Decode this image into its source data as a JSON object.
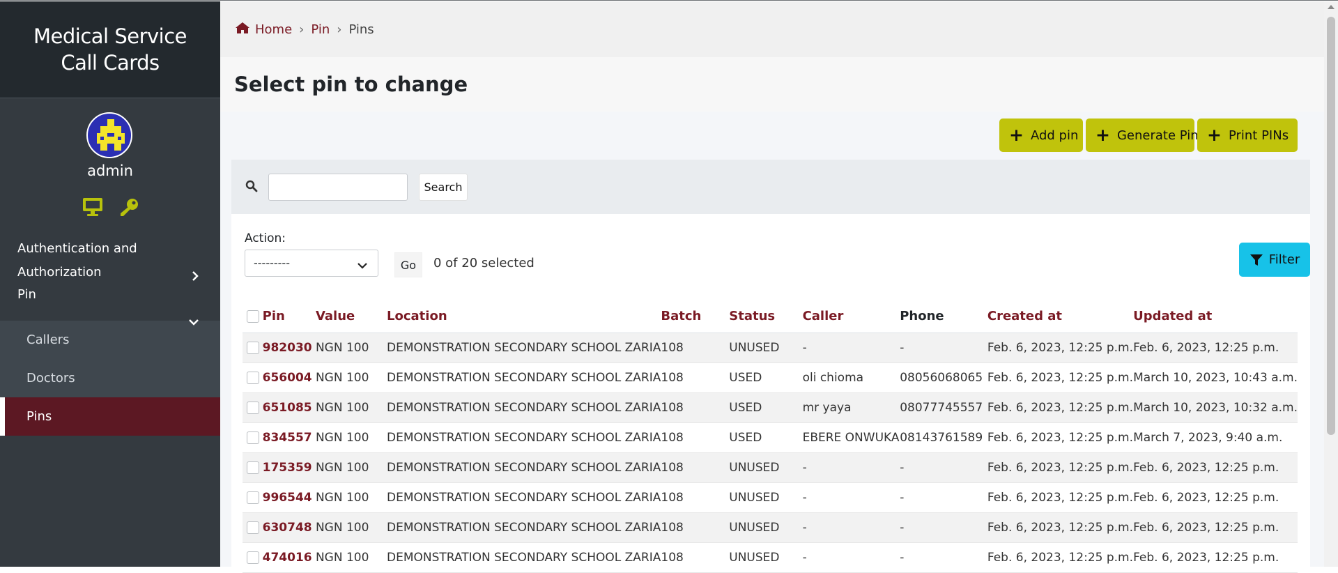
{
  "brand": {
    "title": "Medical Service Call Cards"
  },
  "user": {
    "name": "admin",
    "icons": [
      "monitor-icon",
      "key-icon"
    ]
  },
  "sidebar": {
    "items": [
      {
        "label": "Authentication and Authorization",
        "icon": "chevron-right-icon"
      },
      {
        "label": "Pin",
        "icon": "chevron-down-icon"
      }
    ],
    "subitems": [
      {
        "label": "Callers"
      },
      {
        "label": "Doctors"
      },
      {
        "label": "Pins",
        "active": true
      }
    ]
  },
  "breadcrumb": {
    "home": "Home",
    "sep": "›",
    "pin": "Pin",
    "current": "Pins"
  },
  "page": {
    "title": "Select pin to change"
  },
  "toolbar": {
    "add_pin": "Add pin",
    "generate_pin": "Generate Pin",
    "print_pins": "Print PINs",
    "accent": "#c0c30c"
  },
  "search": {
    "value": "",
    "button": "Search"
  },
  "actions": {
    "label": "Action:",
    "selected": "---------",
    "go": "Go",
    "count": "0 of 20 selected"
  },
  "filter": {
    "label": "Filter",
    "color": "#17c2e8"
  },
  "table": {
    "columns": [
      "Pin",
      "Value",
      "Location",
      "Batch",
      "Status",
      "Caller",
      "Phone",
      "Created at",
      "Updated at"
    ],
    "rows": [
      [
        "982030",
        "NGN 100",
        "DEMONSTRATION SECONDARY SCHOOL ZARIA",
        "108",
        "UNUSED",
        "-",
        "-",
        "Feb. 6, 2023, 12:25 p.m.",
        "Feb. 6, 2023, 12:25 p.m."
      ],
      [
        "656004",
        "NGN 100",
        "DEMONSTRATION SECONDARY SCHOOL ZARIA",
        "108",
        "USED",
        "oli chioma",
        "08056068065",
        "Feb. 6, 2023, 12:25 p.m.",
        "March 10, 2023, 10:43 a.m."
      ],
      [
        "651085",
        "NGN 100",
        "DEMONSTRATION SECONDARY SCHOOL ZARIA",
        "108",
        "USED",
        "mr yaya",
        "08077745557",
        "Feb. 6, 2023, 12:25 p.m.",
        "March 10, 2023, 10:32 a.m."
      ],
      [
        "834557",
        "NGN 100",
        "DEMONSTRATION SECONDARY SCHOOL ZARIA",
        "108",
        "USED",
        "EBERE ONWUKA",
        "08143761589",
        "Feb. 6, 2023, 12:25 p.m.",
        "March 7, 2023, 9:40 a.m."
      ],
      [
        "175359",
        "NGN 100",
        "DEMONSTRATION SECONDARY SCHOOL ZARIA",
        "108",
        "UNUSED",
        "-",
        "-",
        "Feb. 6, 2023, 12:25 p.m.",
        "Feb. 6, 2023, 12:25 p.m."
      ],
      [
        "996544",
        "NGN 100",
        "DEMONSTRATION SECONDARY SCHOOL ZARIA",
        "108",
        "UNUSED",
        "-",
        "-",
        "Feb. 6, 2023, 12:25 p.m.",
        "Feb. 6, 2023, 12:25 p.m."
      ],
      [
        "630748",
        "NGN 100",
        "DEMONSTRATION SECONDARY SCHOOL ZARIA",
        "108",
        "UNUSED",
        "-",
        "-",
        "Feb. 6, 2023, 12:25 p.m.",
        "Feb. 6, 2023, 12:25 p.m."
      ],
      [
        "474016",
        "NGN 100",
        "DEMONSTRATION SECONDARY SCHOOL ZARIA",
        "108",
        "UNUSED",
        "-",
        "-",
        "Feb. 6, 2023, 12:25 p.m.",
        "Feb. 6, 2023, 12:25 p.m."
      ]
    ]
  },
  "colors": {
    "sidebar": "#343a40",
    "brand_bg": "#23292e",
    "link": "#7a1a24",
    "active_nav": "#5c1823"
  }
}
